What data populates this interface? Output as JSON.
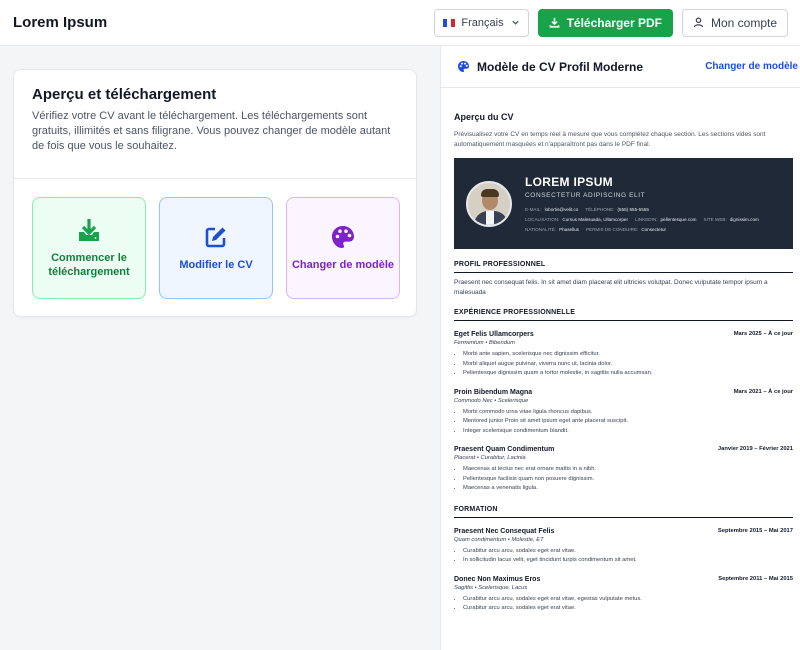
{
  "header": {
    "brand": "Lorem Ipsum",
    "language": "Français",
    "download_label": "Télécharger PDF",
    "account_label": "Mon compte",
    "colors": {
      "primary": "#16a34a"
    }
  },
  "card": {
    "title": "Aperçu et téléchargement",
    "description": "Vérifiez votre CV avant le téléchargement. Les téléchargements sont gratuits, illimités et sans filigrane. Vous pouvez changer de modèle autant de fois que vous le souhaitez.",
    "tiles": [
      {
        "label": "Commencer le téléchargement",
        "icon": "download-icon"
      },
      {
        "label": "Modifier le CV",
        "icon": "edit-icon"
      },
      {
        "label": "Changer de modèle",
        "icon": "palette-icon"
      }
    ]
  },
  "panel": {
    "title": "Modèle de CV Profil Moderne",
    "change_link": "Changer de modèle",
    "preview_title": "Aperçu du CV",
    "preview_desc": "Prévisualisez votre CV en temps réel à mesure que vous complétez chaque section. Les sections vides sont automatiquement masquées et n'apparaîtront pas dans le PDF final."
  },
  "resume": {
    "name": "LOREM IPSUM",
    "subtitle": "CONSECTETUR ADIPISCING ELIT",
    "contact_row1": [
      {
        "k": "E-mail:",
        "v": "lobortis@velit.co"
      },
      {
        "k": "Téléphone:",
        "v": "(555) 555-5555"
      }
    ],
    "contact_row2": [
      {
        "k": "Localisation:",
        "v": "Cursus Malesuada, Ullamcorper"
      },
      {
        "k": "LinkedIn:",
        "v": "pellentesque.com"
      },
      {
        "k": "Site Web:",
        "v": "dignissim.com"
      }
    ],
    "contact_row3": [
      {
        "k": "Nationalité:",
        "v": "Phasellus"
      },
      {
        "k": "Permis de conduire:",
        "v": "Consectetur"
      }
    ],
    "profile_heading": "PROFIL PROFESSIONNEL",
    "profile_text": "Praesent nec consequat felis. In sit amet diam placerat elit ultricies volutpat. Donec vulputate tempor ipsum a malesuada",
    "experience_heading": "EXPÉRIENCE PROFESSIONNELLE",
    "experience": [
      {
        "title": "Eget Felis Ullamcorpers",
        "date": "Mars 2025 – À ce jour",
        "company": "Fermentum • Bibendum",
        "bullets": [
          "Morbi ante sapien, scelerisque nec dignissim efficitur.",
          "Morbi aliquet augue pulvinar, viverra nunc ut, lacinia dolor.",
          "Pellentesque dignissim quam a tortor molestie, in sagittis nulla accumsan."
        ]
      },
      {
        "title": "Proin Bibendum Magna",
        "date": "Mars 2021 – À ce jour",
        "company": "Commodo Nec • Scelerisque",
        "bullets": [
          "Morbi commodo urna vitae ligula rhoncus dapibus.",
          "Mentored junior Proin sit amet ipsum eget ante placerat suscipit.",
          "Integer scelerisque condimentum blandit."
        ]
      },
      {
        "title": "Praesent Quam Condimentum",
        "date": "Janvier 2019 – Février 2021",
        "company": "Placerat • Curabitur, Lacinia",
        "bullets": [
          "Maecenas at lectus nec erat ornare mattis in a nibh.",
          "Pellentesque facilisis quam non posuere dignissim.",
          "Maecenas a venenatis ligula."
        ]
      }
    ],
    "education_heading": "FORMATION",
    "education": [
      {
        "title": "Praesent Nec Consequat Felis",
        "date": "Septembre 2015 – Mai 2017",
        "company": "Quam condimentum • Molestie, ET",
        "bullets": [
          "Curabitur arcu arcu, sodales eget erat vitae.",
          "In sollicitudin lacus velit, eget tincidunt turpis condimentum sit amet."
        ]
      },
      {
        "title": "Donec Non Maximus Eros",
        "date": "Septembre 2011 – Mai 2015",
        "company": "Sagittis • Scelerisque, Lacus",
        "bullets": [
          "Curabitur arcu arcu, sodales eget erat vitae, egestas vulputate metus.",
          "Curabitur arcu arcu, sodales eget erat vitae."
        ]
      }
    ]
  }
}
